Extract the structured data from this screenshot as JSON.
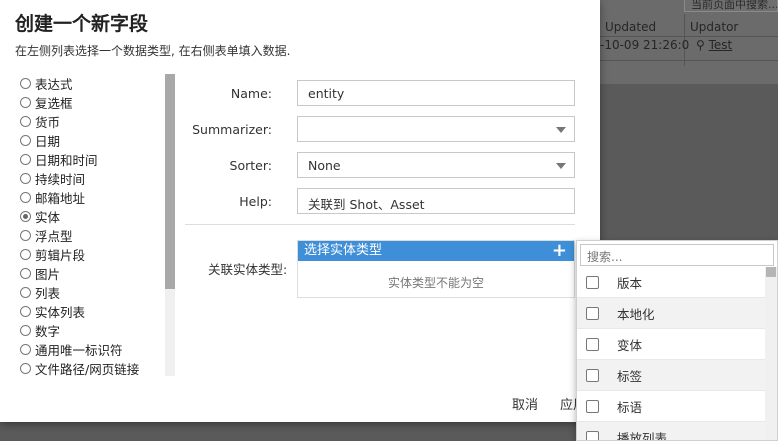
{
  "background": {
    "search_text": "当前页面中搜索...",
    "columns": [
      "Updated",
      "Updator"
    ],
    "row": {
      "updated": "-10-09 21:26:0",
      "updator": "Test"
    }
  },
  "dialog": {
    "title": "创建一个新字段",
    "subtitle": "在左侧列表选择一个数据类型, 在右侧表单填入数据.",
    "types": [
      {
        "label": "表达式",
        "checked": false
      },
      {
        "label": "复选框",
        "checked": false
      },
      {
        "label": "货币",
        "checked": false
      },
      {
        "label": "日期",
        "checked": false
      },
      {
        "label": "日期和时间",
        "checked": false
      },
      {
        "label": "持续时间",
        "checked": false
      },
      {
        "label": "邮箱地址",
        "checked": false
      },
      {
        "label": "实体",
        "checked": true
      },
      {
        "label": "浮点型",
        "checked": false
      },
      {
        "label": "剪辑片段",
        "checked": false
      },
      {
        "label": "图片",
        "checked": false
      },
      {
        "label": "列表",
        "checked": false
      },
      {
        "label": "实体列表",
        "checked": false
      },
      {
        "label": "数字",
        "checked": false
      },
      {
        "label": "通用唯一标识符",
        "checked": false
      },
      {
        "label": "文件路径/网页链接",
        "checked": false
      }
    ],
    "form": {
      "name_label": "Name:",
      "name_value": "entity",
      "summarizer_label": "Summarizer:",
      "summarizer_value": "",
      "sorter_label": "Sorter:",
      "sorter_value": "None",
      "help_label": "Help:",
      "help_value": "关联到 Shot、Asset"
    },
    "entity_type": {
      "label": "关联实体类型:",
      "header": "选择实体类型",
      "empty_message": "实体类型不能为空"
    },
    "footer": {
      "cancel": "取消",
      "apply": "应用"
    }
  },
  "popup": {
    "search_placeholder": "搜索...",
    "items": [
      "版本",
      "本地化",
      "变体",
      "标签",
      "标语",
      "播放列表"
    ]
  },
  "colors": {
    "accent": "#3e8fd8"
  }
}
